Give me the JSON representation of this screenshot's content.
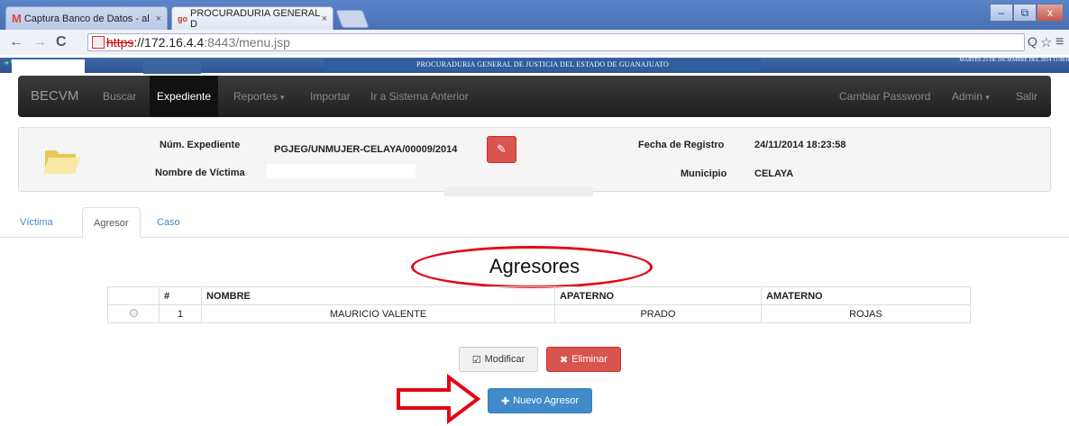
{
  "browser": {
    "tabs": [
      {
        "label": "Captura Banco de Datos - al",
        "close": "×"
      },
      {
        "label": "PROCURADURIA GENERAL D",
        "close": "×"
      }
    ],
    "window_controls": {
      "minimize": "‒",
      "maximize": "⧉",
      "close": "x"
    },
    "url": {
      "scheme": "https",
      "host": "://172.16.4.4",
      "path": ":8443/menu.jsp"
    },
    "nav": {
      "back": "←",
      "forward": "→",
      "reload": "C",
      "zoom": "Q",
      "star": "☆",
      "menu": "≡"
    }
  },
  "site_header": {
    "title": "PROCURADURIA GENERAL DE JUSTICIA DEL ESTADO DE GUANAJUATO",
    "date": "MARTES 23 DE DICIEMBRE DEL 2014 11:06:0",
    "left_tag": "VE"
  },
  "navbar": {
    "brand": "BECVM",
    "items": [
      "Buscar",
      "Expediente",
      "Reportes",
      "Importar",
      "Ir a Sistema Anterior"
    ],
    "right": [
      "Cambiar Password",
      "Admin",
      "Salir"
    ],
    "caret": "▾"
  },
  "record": {
    "expediente_label": "Núm. Expediente",
    "expediente_value": "PGJEG/UNMUJER-CELAYA/00009/2014",
    "victima_label": "Nombre de Víctima",
    "fecha_label": "Fecha de Registro",
    "fecha_value": "24/11/2014 18:23:58",
    "municipio_label": "Municipio",
    "municipio_value": "CELAYA"
  },
  "tabs": [
    "Víctima",
    "Agresor",
    "Caso"
  ],
  "section_title": "Agresores",
  "table": {
    "headers": [
      "",
      "#",
      "NOMBRE",
      "APATERNO",
      "AMATERNO"
    ],
    "rows": [
      {
        "num": "1",
        "nombre": "MAURICIO VALENTE",
        "apaterno": "PRADO",
        "amaterno": "ROJAS"
      }
    ]
  },
  "buttons": {
    "modificar": "Modificar",
    "eliminar": "Eliminar",
    "nuevo": "Nuevo Agresor",
    "modificar_icon": "☑",
    "eliminar_icon": "✖",
    "nuevo_icon": "✚"
  },
  "colors": {
    "annotation_red": "#e30613",
    "primary": "#428bca",
    "danger": "#d9534f"
  }
}
